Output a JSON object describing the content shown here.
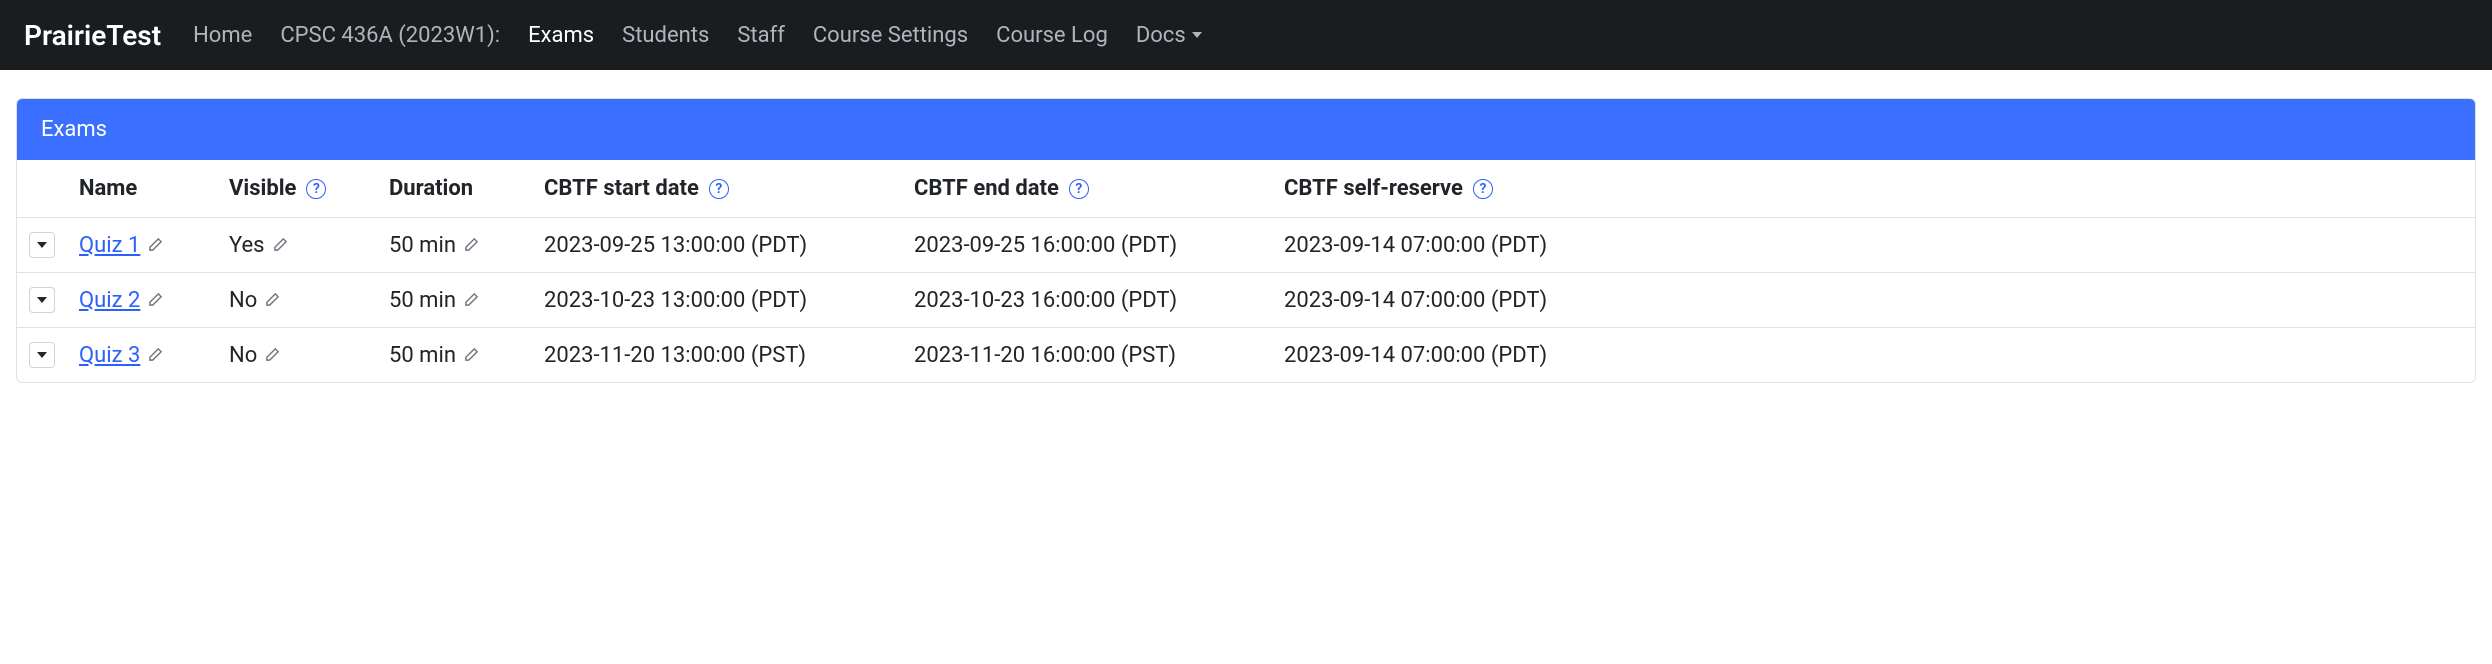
{
  "navbar": {
    "brand": "PrairieTest",
    "links": {
      "home": "Home",
      "course": "CPSC 436A (2023W1):",
      "exams": "Exams",
      "students": "Students",
      "staff": "Staff",
      "settings": "Course Settings",
      "log": "Course Log",
      "docs": "Docs"
    }
  },
  "card": {
    "title": "Exams"
  },
  "table": {
    "headers": {
      "name": "Name",
      "visible": "Visible",
      "duration": "Duration",
      "start": "CBTF start date",
      "end": "CBTF end date",
      "reserve": "CBTF self-reserve"
    },
    "rows": [
      {
        "name": "Quiz 1",
        "visible": "Yes",
        "duration": "50 min",
        "start": "2023-09-25 13:00:00 (PDT)",
        "end": "2023-09-25 16:00:00 (PDT)",
        "reserve": "2023-09-14 07:00:00 (PDT)"
      },
      {
        "name": "Quiz 2",
        "visible": "No",
        "duration": "50 min",
        "start": "2023-10-23 13:00:00 (PDT)",
        "end": "2023-10-23 16:00:00 (PDT)",
        "reserve": "2023-09-14 07:00:00 (PDT)"
      },
      {
        "name": "Quiz 3",
        "visible": "No",
        "duration": "50 min",
        "start": "2023-11-20 13:00:00 (PST)",
        "end": "2023-11-20 16:00:00 (PST)",
        "reserve": "2023-09-14 07:00:00 (PDT)"
      }
    ]
  }
}
